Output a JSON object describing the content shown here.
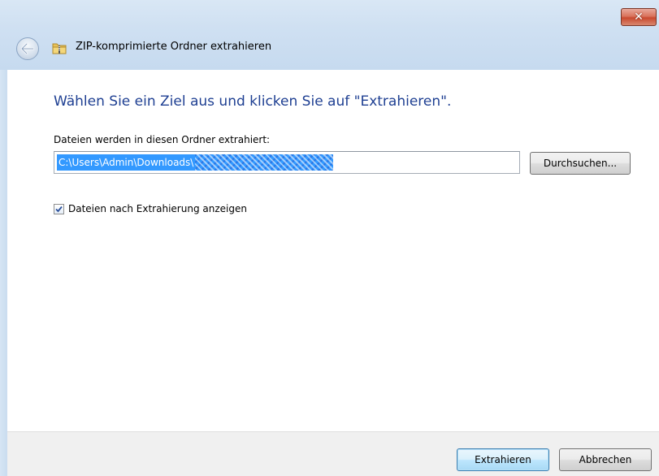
{
  "window": {
    "title": "ZIP-komprimierte Ordner extrahieren",
    "close_label": "✕"
  },
  "icons": {
    "back": "back-arrow-icon",
    "folder": "zip-folder-icon",
    "close": "close-icon",
    "check": "checkmark-icon"
  },
  "main": {
    "heading": "Wählen Sie ein Ziel aus und klicken Sie auf \"Extrahieren\".",
    "path_label": "Dateien werden in diesen Ordner extrahiert:",
    "path_value_visible": "C:\\Users\\Admin\\Downloads\\",
    "browse_label": "Durchsuchen...",
    "show_files_label": "Dateien nach Extrahierung anzeigen",
    "show_files_checked": true
  },
  "footer": {
    "extract_label": "Extrahieren",
    "cancel_label": "Abbrechen"
  },
  "colors": {
    "heading": "#1e3f92",
    "selection": "#3399ff",
    "close_button": "#c94a30"
  }
}
